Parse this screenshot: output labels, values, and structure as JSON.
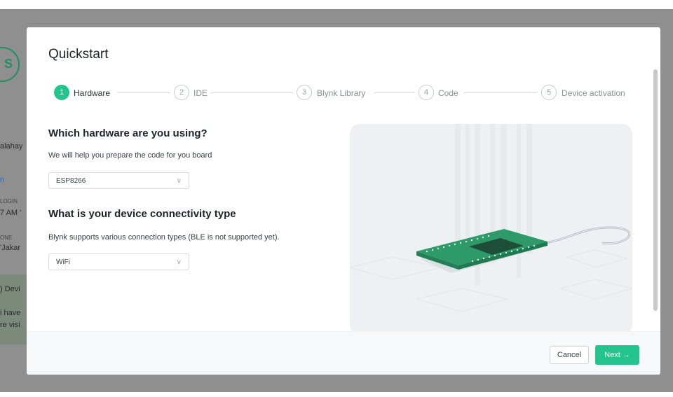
{
  "background": {
    "logo_letter": "S",
    "name_fragment": "alahay",
    "link_fragment": "n",
    "last_login_label": "LOGIN",
    "last_login_value": "7 AM '",
    "timezone_label": "ONE",
    "timezone_value": "'Jakar",
    "devices_fragment": ") Devi",
    "notice_line1": "i have",
    "notice_line2": "re visi"
  },
  "modal": {
    "title": "Quickstart",
    "steps": [
      {
        "num": "1",
        "label": "Hardware"
      },
      {
        "num": "2",
        "label": "IDE"
      },
      {
        "num": "3",
        "label": "Blynk Library"
      },
      {
        "num": "4",
        "label": "Code"
      },
      {
        "num": "5",
        "label": "Device activation"
      }
    ],
    "active_step": 1,
    "hardware": {
      "heading": "Which hardware are you using?",
      "description": "We will help you prepare the code for you board",
      "selected": "ESP8266"
    },
    "connectivity": {
      "heading": "What is your device connectivity type",
      "description": "Blynk supports various connection types (BLE is not supported yet).",
      "selected": "WiFi"
    },
    "footer": {
      "cancel_label": "Cancel",
      "next_label": "Next →"
    }
  },
  "colors": {
    "accent": "#23c48e",
    "overlay": "#8f8f8f"
  }
}
